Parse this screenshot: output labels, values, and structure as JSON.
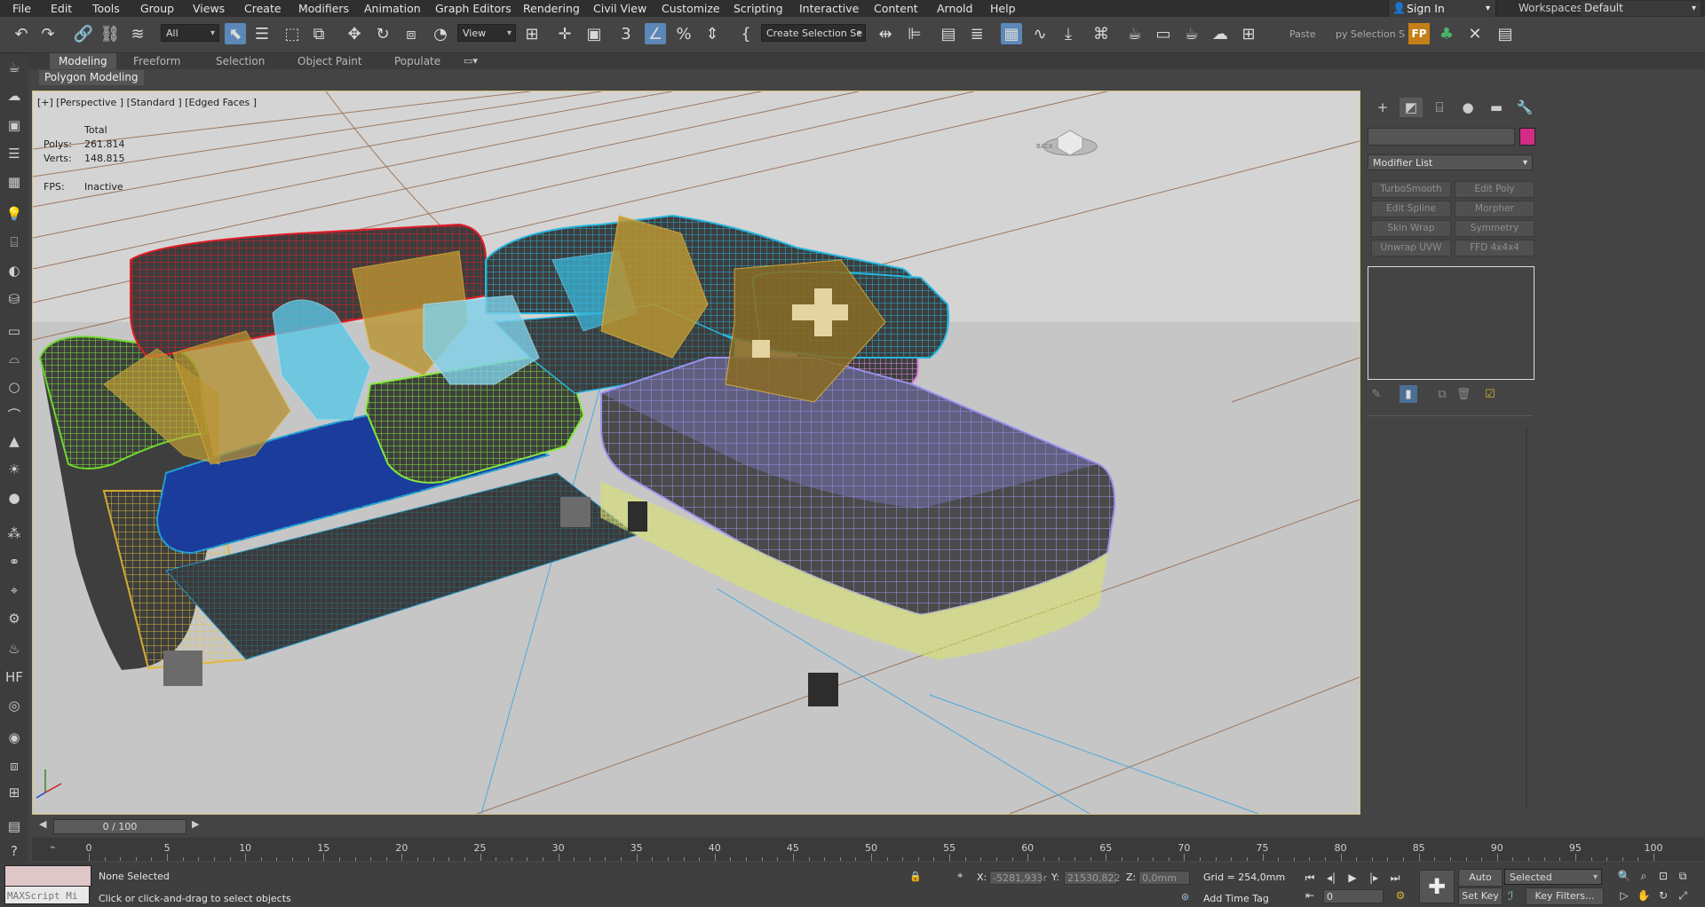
{
  "menu": [
    "File",
    "Edit",
    "Tools",
    "Group",
    "Views",
    "Create",
    "Modifiers",
    "Animation",
    "Graph Editors",
    "Rendering",
    "Civil View",
    "Customize",
    "Scripting",
    "Interactive",
    "Content",
    "Arnold",
    "Help"
  ],
  "account": {
    "sign_in": "Sign In",
    "workspaces_label": "Workspaces:",
    "workspace": "Default"
  },
  "toolbar": {
    "filter": "All",
    "ref_coord": "View",
    "selection_set": "Create Selection Se",
    "paste": "Paste",
    "copy_selection": "py Selection S",
    "fp_label": "FP"
  },
  "ribbon": {
    "tabs": [
      "Modeling",
      "Freeform",
      "Selection",
      "Object Paint",
      "Populate"
    ],
    "active": "Modeling",
    "panel": "Polygon Modeling"
  },
  "viewport": {
    "label": "[+] [Perspective ] [Standard ] [Edged Faces ]",
    "stats_header": "Total",
    "polys_label": "Polys:",
    "polys": "261.814",
    "verts_label": "Verts:",
    "verts": "148.815",
    "fps_label": "FPS:",
    "fps": "Inactive",
    "viewcube_label": "BACK"
  },
  "command_panel": {
    "modifier_list": "Modifier List",
    "buttons": [
      "TurboSmooth",
      "Edit Poly",
      "Edit Spline",
      "Morpher",
      "Skin Wrap",
      "Symmetry",
      "Unwrap UVW",
      "FFD 4x4x4"
    ],
    "object_color": "#d12d84"
  },
  "timeline": {
    "frame_display": "0 / 100",
    "ticks": [
      "0",
      "5",
      "10",
      "15",
      "20",
      "25",
      "30",
      "35",
      "40",
      "45",
      "50",
      "55",
      "60",
      "65",
      "70",
      "75",
      "80",
      "85",
      "90",
      "95",
      "100"
    ]
  },
  "status": {
    "maxscript": "MAXScript Mi",
    "selection": "None Selected",
    "prompt": "Click or click-and-drag to select objects",
    "x_label": "X:",
    "x": "-5281,933r",
    "y_label": "Y:",
    "y": "21530,822",
    "z_label": "Z:",
    "z": "0,0mm",
    "grid": "Grid = 254,0mm",
    "add_time_tag": "Add Time Tag",
    "auto_key": "Auto Key",
    "set_key": "Set Key",
    "key_mode": "Selected",
    "frame": "0",
    "key_filters": "Key Filters..."
  }
}
